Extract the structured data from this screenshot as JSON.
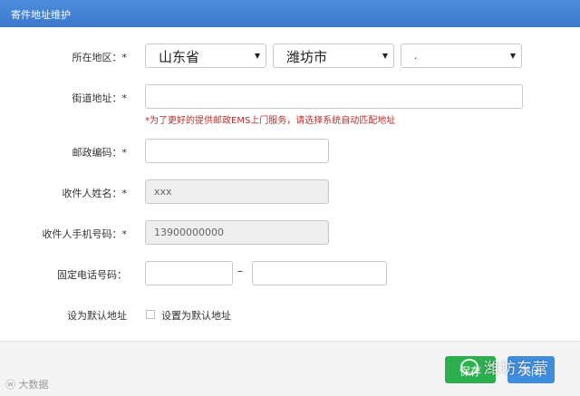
{
  "dialog": {
    "title": "寄件地址维护"
  },
  "form": {
    "region": {
      "label": "所在地区：*",
      "province": "山东省",
      "city": "潍坊市",
      "district": "."
    },
    "street": {
      "label": "街道地址：*",
      "value": "",
      "hint": "*为了更好的提供邮政EMS上门服务，请选择系统自动匹配地址"
    },
    "postcode": {
      "label": "邮政编码：*",
      "value": ""
    },
    "name": {
      "label": "收件人姓名：*",
      "value": "xxx"
    },
    "mobile": {
      "label": "收件人手机号码：*",
      "value": "13900000000"
    },
    "phone": {
      "label": "固定电话号码：",
      "area": "",
      "number": "",
      "separator": "–"
    },
    "default": {
      "label": "设为默认地址",
      "checkbox_label": "设置为默认地址",
      "checked": false
    }
  },
  "footer": {
    "save_label": "保存",
    "close_label": "关闭"
  },
  "watermark": {
    "main": "潍坊东营",
    "corner": "大数据"
  },
  "colors": {
    "titlebar": "#3a78cc",
    "save": "#2daf4f",
    "close": "#3f8ddc",
    "hint": "#b5302e"
  }
}
